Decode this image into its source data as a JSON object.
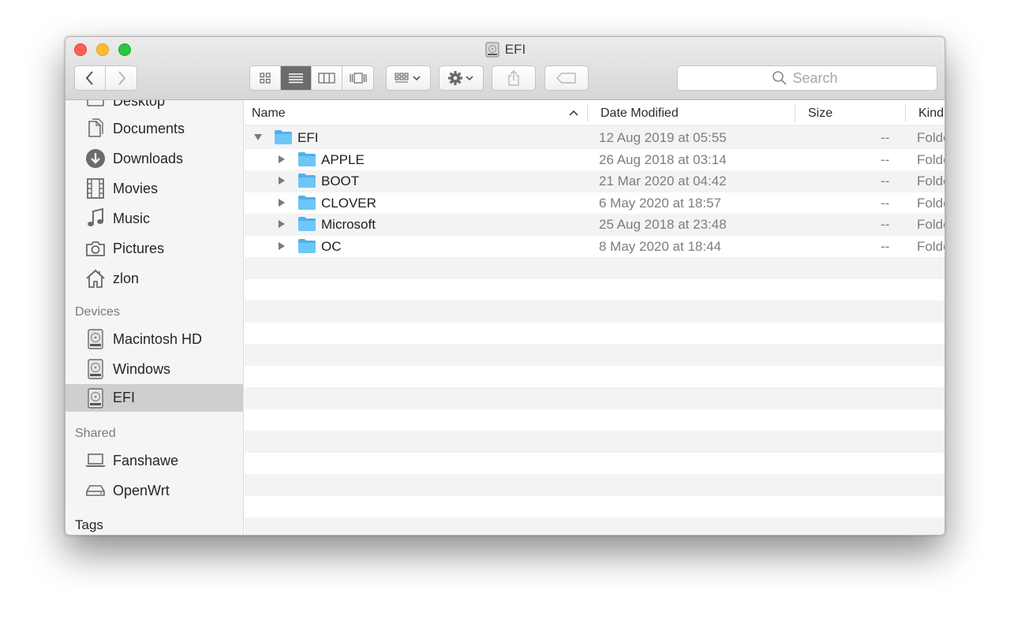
{
  "window": {
    "title": "EFI"
  },
  "toolbar": {
    "back_icon": "chevron-left-icon",
    "forward_icon": "chevron-right-icon",
    "view_modes": [
      "icon-view-icon",
      "list-view-icon",
      "column-view-icon",
      "coverflow-view-icon"
    ],
    "active_view": "list",
    "arrange_icon": "arrange-icon",
    "action_icon": "gear-icon",
    "share_icon": "share-icon",
    "tag_icon": "tag-icon",
    "search_placeholder": "Search"
  },
  "sidebar": {
    "partial_top_item": "Desktop",
    "favorites": [
      {
        "label": "Documents",
        "icon": "documents-icon"
      },
      {
        "label": "Downloads",
        "icon": "downloads-icon"
      },
      {
        "label": "Movies",
        "icon": "movies-icon"
      },
      {
        "label": "Music",
        "icon": "music-icon"
      },
      {
        "label": "Pictures",
        "icon": "pictures-icon"
      },
      {
        "label": "zlon",
        "icon": "home-icon"
      }
    ],
    "devices_header": "Devices",
    "devices": [
      {
        "label": "Macintosh HD",
        "icon": "disk-icon"
      },
      {
        "label": "Windows",
        "icon": "disk-icon"
      },
      {
        "label": "EFI",
        "icon": "disk-icon",
        "selected": true
      }
    ],
    "shared_header": "Shared",
    "shared": [
      {
        "label": "Fanshawe",
        "icon": "laptop-icon"
      },
      {
        "label": "OpenWrt",
        "icon": "server-icon"
      }
    ],
    "tags_header": "Tags"
  },
  "columns": {
    "name": "Name",
    "date": "Date Modified",
    "size": "Size",
    "kind": "Kind"
  },
  "files": [
    {
      "name": "EFI",
      "date": "12 Aug 2019 at 05:55",
      "size": "--",
      "kind": "Folder",
      "expanded": true,
      "level": 0
    },
    {
      "name": "APPLE",
      "date": "26 Aug 2018 at 03:14",
      "size": "--",
      "kind": "Folder",
      "expanded": false,
      "level": 1
    },
    {
      "name": "BOOT",
      "date": "21 Mar 2020 at 04:42",
      "size": "--",
      "kind": "Folder",
      "expanded": false,
      "level": 1
    },
    {
      "name": "CLOVER",
      "date": "6 May 2020 at 18:57",
      "size": "--",
      "kind": "Folder",
      "expanded": false,
      "level": 1
    },
    {
      "name": "Microsoft",
      "date": "25 Aug 2018 at 23:48",
      "size": "--",
      "kind": "Folder",
      "expanded": false,
      "level": 1
    },
    {
      "name": "OC",
      "date": "8 May 2020 at 18:44",
      "size": "--",
      "kind": "Folder",
      "expanded": false,
      "level": 1
    }
  ],
  "colors": {
    "folder": "#6ec6f7",
    "selected_sidebar": "#cfcfcf",
    "stripe": "#f3f3f3"
  }
}
